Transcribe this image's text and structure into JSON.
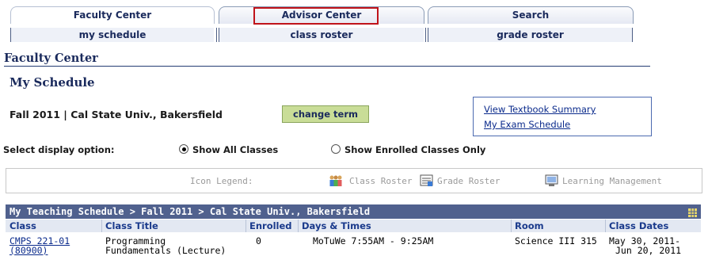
{
  "tabs": [
    {
      "label": "Faculty Center",
      "active": true
    },
    {
      "label": "Advisor Center",
      "active": false
    },
    {
      "label": "Search",
      "active": false
    }
  ],
  "subtabs": [
    "my schedule",
    "class roster",
    "grade roster"
  ],
  "page": {
    "section_title": "Faculty Center",
    "title": "My Schedule"
  },
  "term": {
    "text": "Fall 2011 | Cal State Univ., Bakersfield",
    "change_label": "change term"
  },
  "links": {
    "textbook": "View Textbook Summary",
    "exam": "My Exam Schedule"
  },
  "display_option": {
    "label": "Select display option:",
    "options": [
      {
        "label": "Show All Classes",
        "selected": true
      },
      {
        "label": "Show Enrolled Classes Only",
        "selected": false
      }
    ]
  },
  "legend": {
    "label": "Icon Legend:",
    "items": [
      {
        "icon": "class-roster-icon",
        "label": "Class Roster"
      },
      {
        "icon": "grade-roster-icon",
        "label": "Grade Roster"
      },
      {
        "icon": "learning-management-icon",
        "label": "Learning Management"
      }
    ]
  },
  "schedule": {
    "title": "My Teaching Schedule > Fall 2011 > Cal State Univ., Bakersfield",
    "columns": [
      "Class",
      "Class Title",
      "Enrolled",
      "Days & Times",
      "Room",
      "Class Dates"
    ],
    "rows": [
      {
        "class_line1": "CMPS 221-01",
        "class_line2": "(80900)",
        "title_line1": "Programming",
        "title_line2": "Fundamentals (Lecture)",
        "enrolled": "0",
        "days_times": "MoTuWe 7:55AM - 9:25AM",
        "room": "Science III 315",
        "dates_line1": "May 30, 2011-",
        "dates_line2": "Jun 20, 2011"
      }
    ]
  },
  "colors": {
    "accent": "#50618e",
    "header_text": "#1a2a5c",
    "highlight": "#c0131a",
    "button": "#c9dd97"
  }
}
